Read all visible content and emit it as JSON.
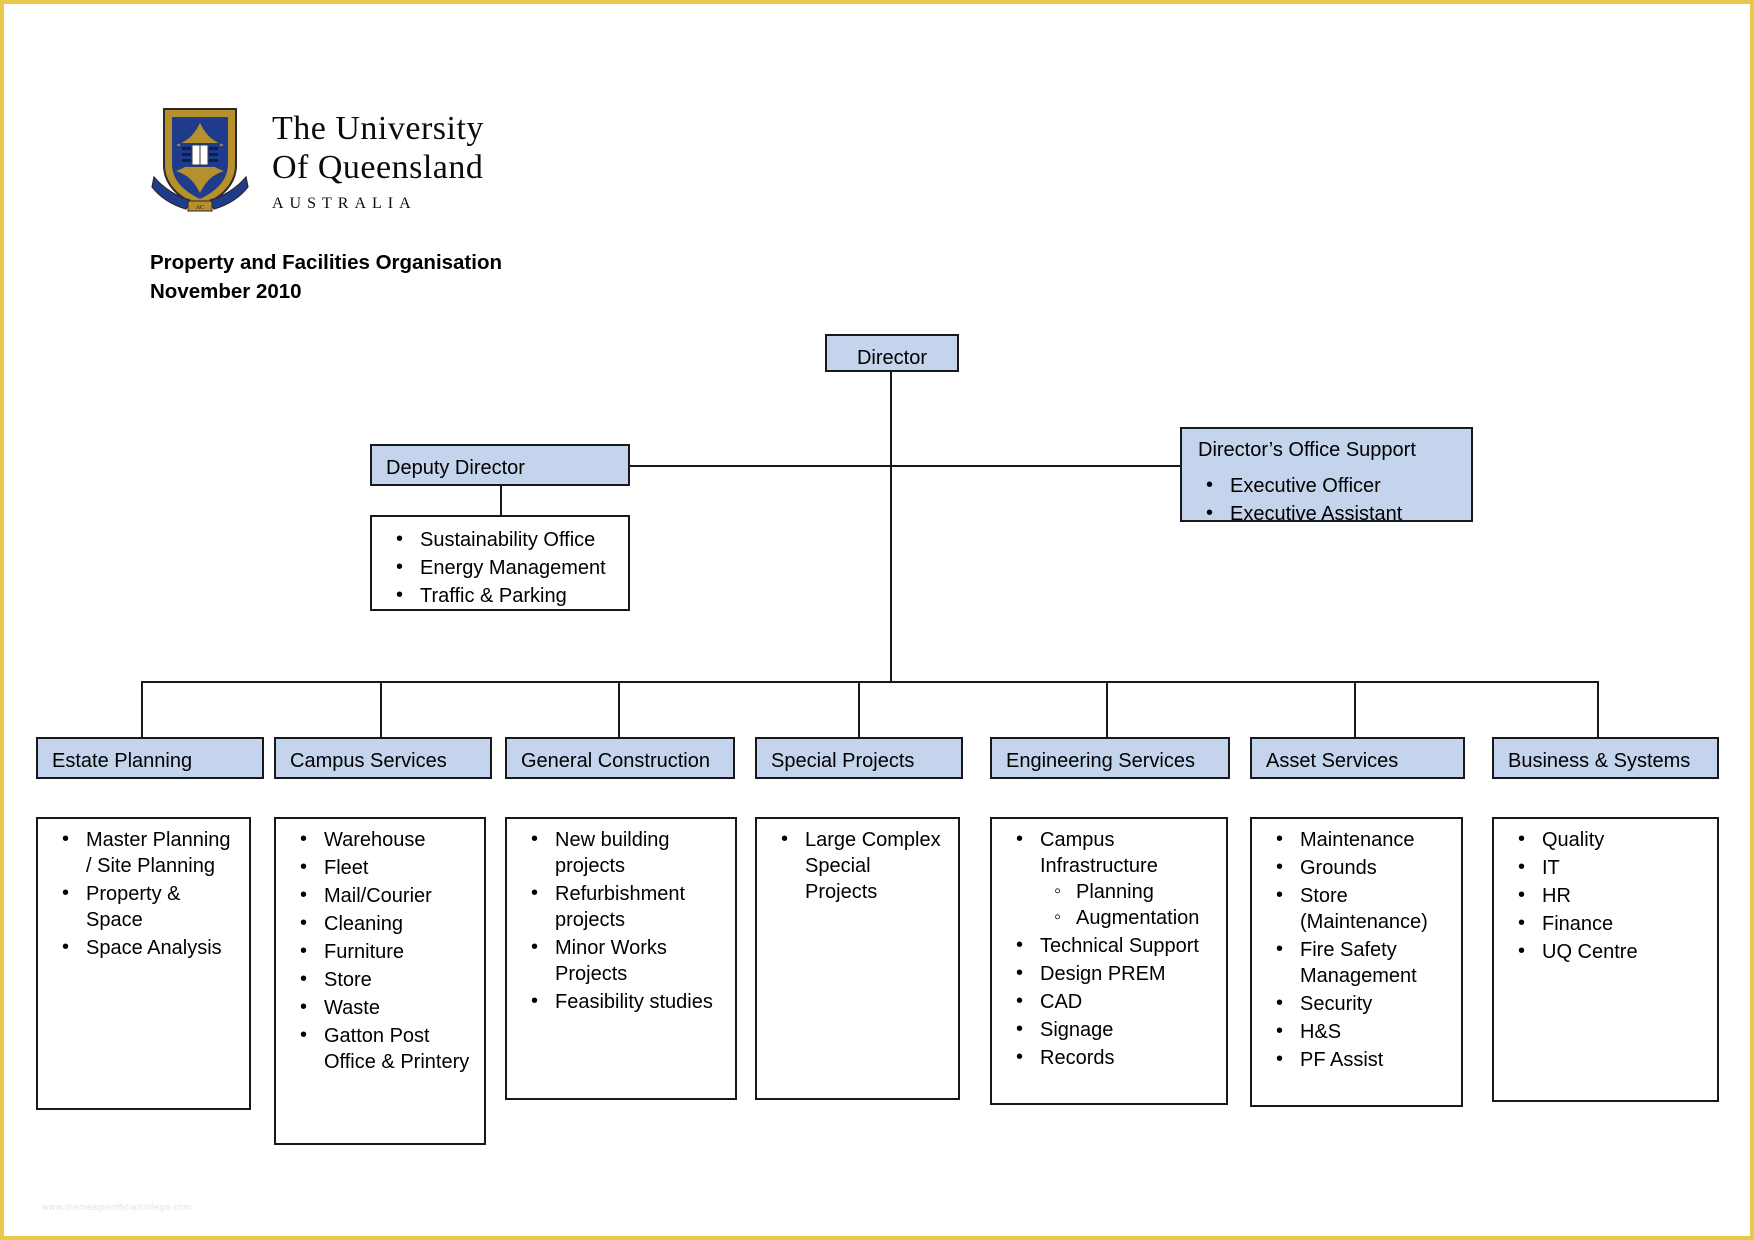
{
  "brand": {
    "line1": "The University",
    "line2": "Of Queensland",
    "line3": "AUSTRALIA",
    "crest_alt": "uq-crest"
  },
  "document": {
    "title": "Property and Facilities Organisation",
    "date": "November 2010"
  },
  "watermark": "www.themeagleofficialcollege.com",
  "colors": {
    "box_fill_blue": "#c3d4ec",
    "box_border": "#18181c",
    "page_border": "#e8c84a",
    "crest_gold": "#b7902e",
    "crest_blue": "#1f3b8c"
  },
  "chart": {
    "director": {
      "label": "Director"
    },
    "deputy_director": {
      "label": "Deputy Director"
    },
    "deputy_director_units": {
      "items": [
        "Sustainability Office",
        "Energy Management",
        "Traffic & Parking"
      ]
    },
    "directors_office_support": {
      "label": "Director’s Office Support",
      "items": [
        "Executive Officer",
        "Executive Assistant"
      ]
    },
    "divisions": [
      {
        "label": "Estate Planning",
        "items": [
          {
            "text": "Master Planning / Site Planning"
          },
          {
            "text": "Property & Space"
          },
          {
            "text": "Space Analysis"
          }
        ]
      },
      {
        "label": "Campus Services",
        "items": [
          {
            "text": "Warehouse"
          },
          {
            "text": "Fleet"
          },
          {
            "text": "Mail/Courier"
          },
          {
            "text": "Cleaning"
          },
          {
            "text": "Furniture"
          },
          {
            "text": "Store"
          },
          {
            "text": "Waste"
          },
          {
            "text": "Gatton Post Office & Printery"
          }
        ]
      },
      {
        "label": "General Construction",
        "items": [
          {
            "text": "New building projects"
          },
          {
            "text": "Refurbishment projects"
          },
          {
            "text": "Minor Works Projects"
          },
          {
            "text": "Feasibility studies"
          }
        ]
      },
      {
        "label": "Special Projects",
        "items": [
          {
            "text": "Large Complex Special Projects"
          }
        ]
      },
      {
        "label": "Engineering Services",
        "items": [
          {
            "text": "Campus Infrastructure",
            "sub": [
              "Planning",
              "Augmentation"
            ]
          },
          {
            "text": "Technical Support"
          },
          {
            "text": "Design PREM"
          },
          {
            "text": "CAD"
          },
          {
            "text": "Signage"
          },
          {
            "text": "Records"
          }
        ]
      },
      {
        "label": "Asset Services",
        "items": [
          {
            "text": "Maintenance"
          },
          {
            "text": "Grounds"
          },
          {
            "text": "Store (Maintenance)"
          },
          {
            "text": "Fire Safety Management"
          },
          {
            "text": "Security"
          },
          {
            "text": "H&S"
          },
          {
            "text": "PF Assist"
          }
        ]
      },
      {
        "label": "Business & Systems",
        "items": [
          {
            "text": "Quality"
          },
          {
            "text": "IT"
          },
          {
            "text": "HR"
          },
          {
            "text": "Finance"
          },
          {
            "text": "UQ Centre"
          }
        ]
      }
    ]
  }
}
